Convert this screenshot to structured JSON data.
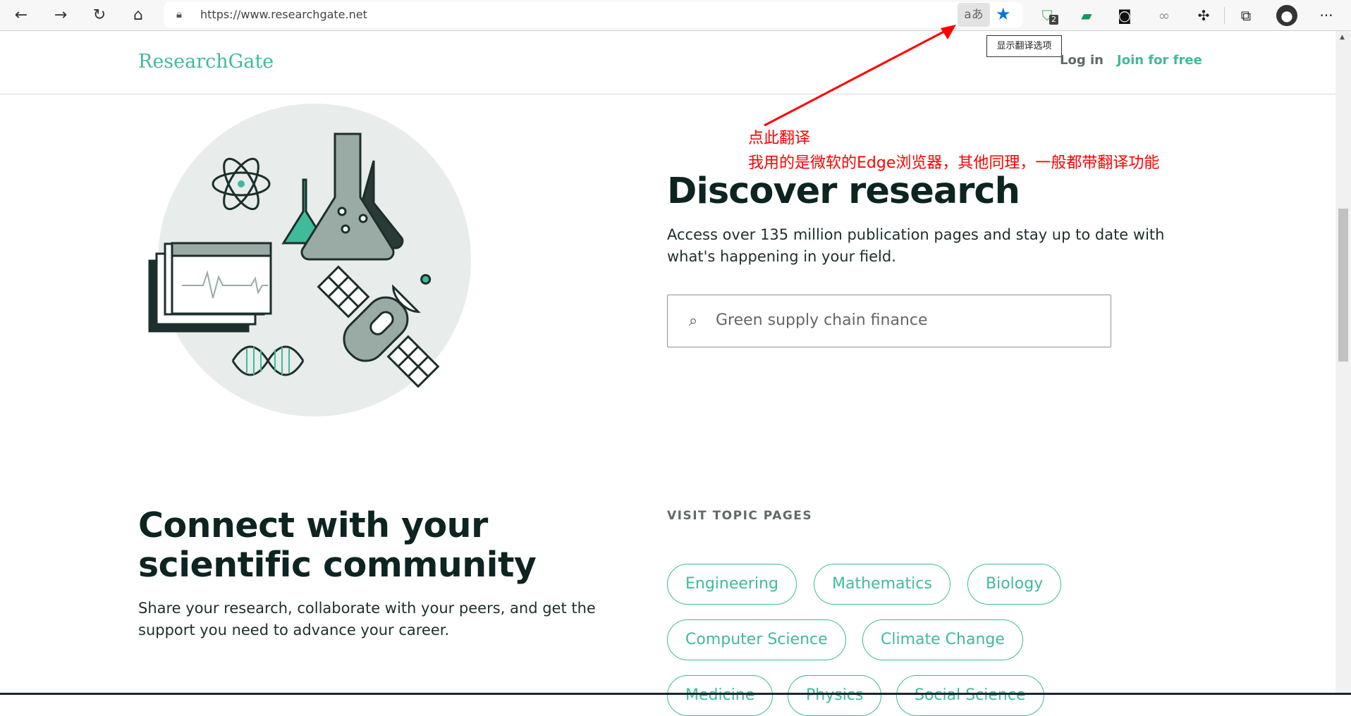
{
  "browser": {
    "url": "https://www.researchgate.net",
    "translate_icon": "aあ",
    "extension_badge": "2",
    "tooltip": "显示翻译选项",
    "more": "···"
  },
  "header": {
    "logo": "ResearchGate",
    "login": "Log in",
    "join": "Join for free"
  },
  "hero": {
    "title": "Discover research",
    "subtitle": "Access over 135 million publication pages and stay up to date with what's happening in your field.",
    "search_placeholder": "Green supply chain finance"
  },
  "annotation": {
    "line1": "点此翻译",
    "line2": "我用的是微软的Edge浏览器，其他同理，一般都带翻译功能",
    "color": "#ff0000"
  },
  "community": {
    "title": "Connect with your scientific community",
    "text": "Share your research, collaborate with your peers, and get the support you need to advance your career."
  },
  "topics": {
    "heading": "VISIT TOPIC PAGES",
    "items": [
      "Engineering",
      "Mathematics",
      "Biology",
      "Computer Science",
      "Climate Change",
      "Medicine",
      "Physics",
      "Social Science"
    ]
  },
  "colors": {
    "brand": "#40ba9b",
    "text": "#0d2421"
  }
}
